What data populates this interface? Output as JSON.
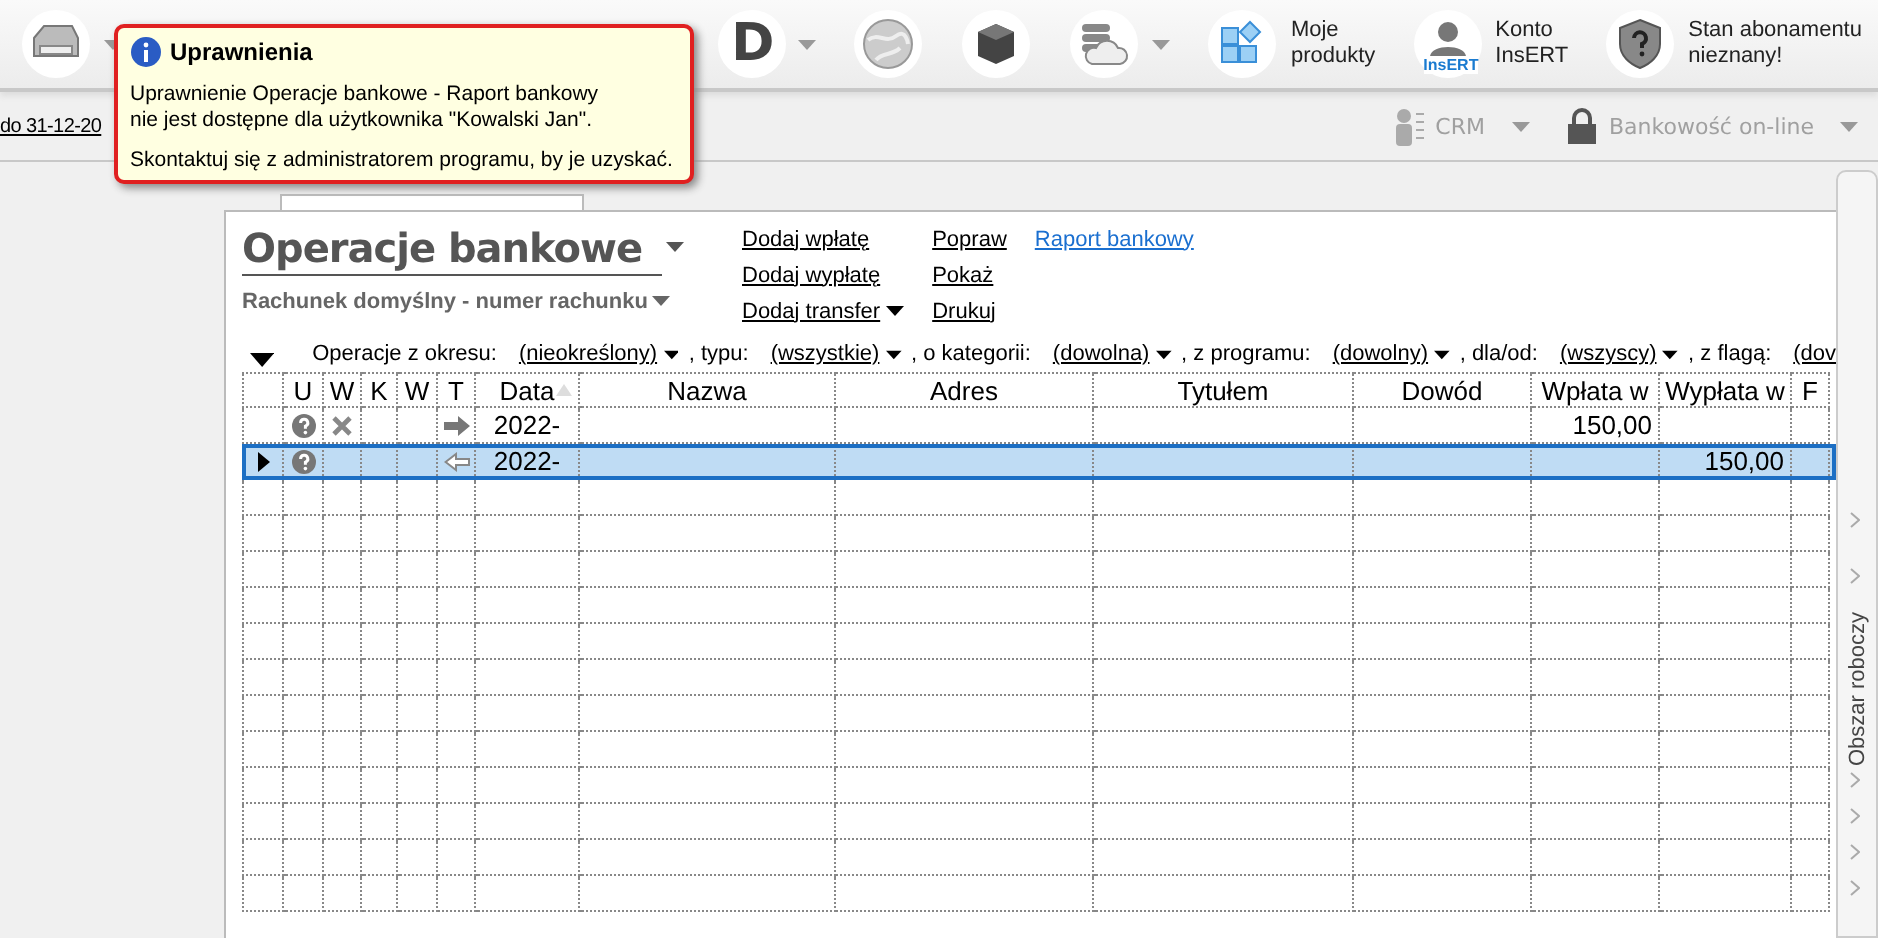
{
  "toolbar": {
    "left": [
      {
        "kind": "printer",
        "caret": true
      }
    ],
    "right": [
      {
        "kind": "letter",
        "label": "D",
        "caret": true
      },
      {
        "kind": "globe",
        "caret": false
      },
      {
        "kind": "cube",
        "caret": false
      },
      {
        "kind": "cloud",
        "caret": true
      },
      {
        "kind": "products",
        "label": "Moje\nprodukty",
        "caret": false
      },
      {
        "kind": "account",
        "label": "Konto\nInsERT",
        "badge": "InsERT",
        "caret": false
      },
      {
        "kind": "shield",
        "label": "Stan abonamentu\nnieznany!",
        "caret": false
      }
    ]
  },
  "subbar": {
    "date_link": "do 31-12-20",
    "modules": [
      {
        "kind": "crm",
        "label": "CRM",
        "disabled": true
      },
      {
        "kind": "lock",
        "label": "Bankowość on-line",
        "disabled": true
      }
    ]
  },
  "popup": {
    "title": "Uprawnienia",
    "paragraphs": [
      [
        "Uprawnienie Operacje bankowe - Raport bankowy",
        "nie jest dostępne dla użytkownika \"Kowalski Jan\"."
      ],
      [
        "Skontaktuj się z administratorem programu, by je uzyskać."
      ]
    ]
  },
  "document": {
    "title": "Operacje bankowe",
    "account": "Rachunek domyślny - numer rachunku",
    "action_columns": [
      [
        {
          "label": "Dodaj wpłatę",
          "caret": false,
          "highlighted": false
        },
        {
          "label": "Dodaj wypłatę",
          "caret": false,
          "highlighted": false
        },
        {
          "label": "Dodaj transfer",
          "caret": true,
          "highlighted": false
        }
      ],
      [
        {
          "label": "Popraw",
          "caret": false,
          "highlighted": false
        },
        {
          "label": "Pokaż",
          "caret": false,
          "highlighted": false
        },
        {
          "label": "Drukuj",
          "caret": false,
          "highlighted": false
        }
      ],
      [
        {
          "label": "Raport bankowy",
          "caret": false,
          "highlighted": true
        }
      ]
    ],
    "filters": [
      {
        "label": "Operacje z okresu:",
        "value": "(nieokreślony)",
        "caret": true
      },
      {
        "label": ", typu:",
        "value": "(wszystkie)",
        "caret": true
      },
      {
        "label": ", o kategorii:",
        "value": "(dowolna)",
        "caret": true
      },
      {
        "label": ", z programu:",
        "value": "(dowolny)",
        "caret": true
      },
      {
        "label": ", dla/od:",
        "value": "(wszyscy)",
        "caret": true
      },
      {
        "label": ", z flagą:",
        "value": "(dov",
        "caret": false
      }
    ],
    "table": {
      "columns": [
        {
          "label": "U",
          "sorted_ascending": false
        },
        {
          "label": "W",
          "sorted_ascending": false
        },
        {
          "label": "K",
          "sorted_ascending": false
        },
        {
          "label": "W",
          "sorted_ascending": false
        },
        {
          "label": "T",
          "sorted_ascending": false
        },
        {
          "label": "Data",
          "sorted_ascending": true
        },
        {
          "label": "Nazwa",
          "sorted_ascending": false
        },
        {
          "label": "Adres",
          "sorted_ascending": false
        },
        {
          "label": "Tytułem",
          "sorted_ascending": false
        },
        {
          "label": "Dowód",
          "sorted_ascending": false
        },
        {
          "label": "Wpłata w",
          "sorted_ascending": false
        },
        {
          "label": "Wypłata w",
          "sorted_ascending": false
        },
        {
          "label": "F",
          "sorted_ascending": false
        }
      ],
      "rows": [
        {
          "selected": false,
          "status_unknown": true,
          "cancelled": true,
          "incoming": true,
          "date": "2022-",
          "deposit": "150,00"
        },
        {
          "selected": true,
          "status_unknown": true,
          "cancelled": false,
          "incoming": false,
          "date": "2022-",
          "withdrawal": "150,00"
        }
      ]
    }
  },
  "side_panel": {
    "title": "Obszar roboczy"
  }
}
